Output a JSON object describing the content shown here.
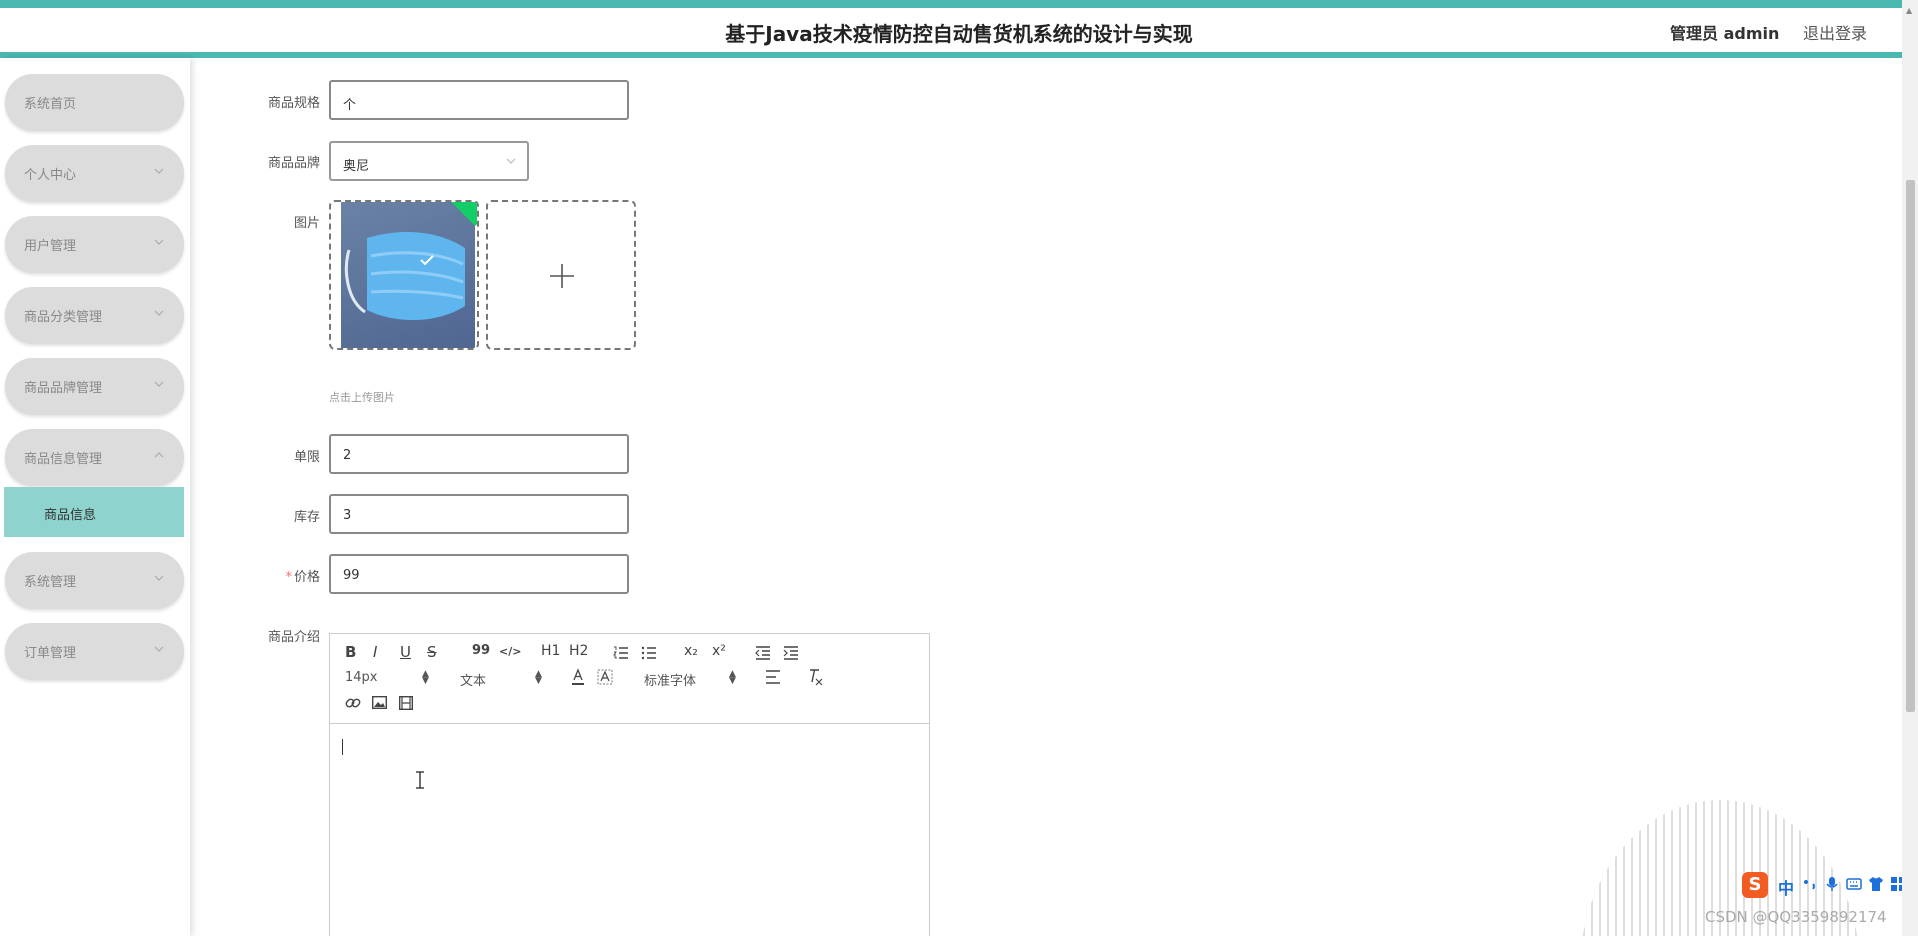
{
  "header": {
    "title": "基于Java技术疫情防控自动售货机系统的设计与实现",
    "user_label": "管理员 admin",
    "logout_label": "退出登录"
  },
  "sidebar": {
    "items": [
      {
        "label": "系统首页",
        "expandable": false
      },
      {
        "label": "个人中心",
        "expandable": true
      },
      {
        "label": "用户管理",
        "expandable": true
      },
      {
        "label": "商品分类管理",
        "expandable": true
      },
      {
        "label": "商品品牌管理",
        "expandable": true
      },
      {
        "label": "商品信息管理",
        "expandable": true,
        "expanded": true
      },
      {
        "label": "系统管理",
        "expandable": true
      },
      {
        "label": "订单管理",
        "expandable": true
      }
    ],
    "submenu": {
      "label": "商品信息",
      "active": true
    }
  },
  "form": {
    "spec": {
      "label": "商品规格",
      "value": "个"
    },
    "brand": {
      "label": "商品品牌",
      "value": "奥尼"
    },
    "image": {
      "label": "图片",
      "hint": "点击上传图片",
      "icons": [
        "mask-thumbnail",
        "plus-icon"
      ]
    },
    "limit": {
      "label": "单限",
      "value": "2"
    },
    "stock": {
      "label": "库存",
      "value": "3"
    },
    "price": {
      "label": "价格",
      "value": "99",
      "required_mark": "*"
    },
    "intro": {
      "label": "商品介绍"
    }
  },
  "editor": {
    "toolbar": {
      "bold": "B",
      "italic": "I",
      "underline": "U",
      "strike": "S",
      "quote": "99",
      "code": "</>",
      "h1": "H1",
      "h2": "H2",
      "sub": "x₂",
      "sup": "x²",
      "size": "14px",
      "header": "文本",
      "font": "标准字体"
    }
  },
  "watermark": "CSDN @QQ3359892174",
  "ime": {
    "text": "中"
  },
  "colors": {
    "accent": "#4bb8b0",
    "submenu_active": "#8fd3cf",
    "success_corner": "#13ce66"
  }
}
